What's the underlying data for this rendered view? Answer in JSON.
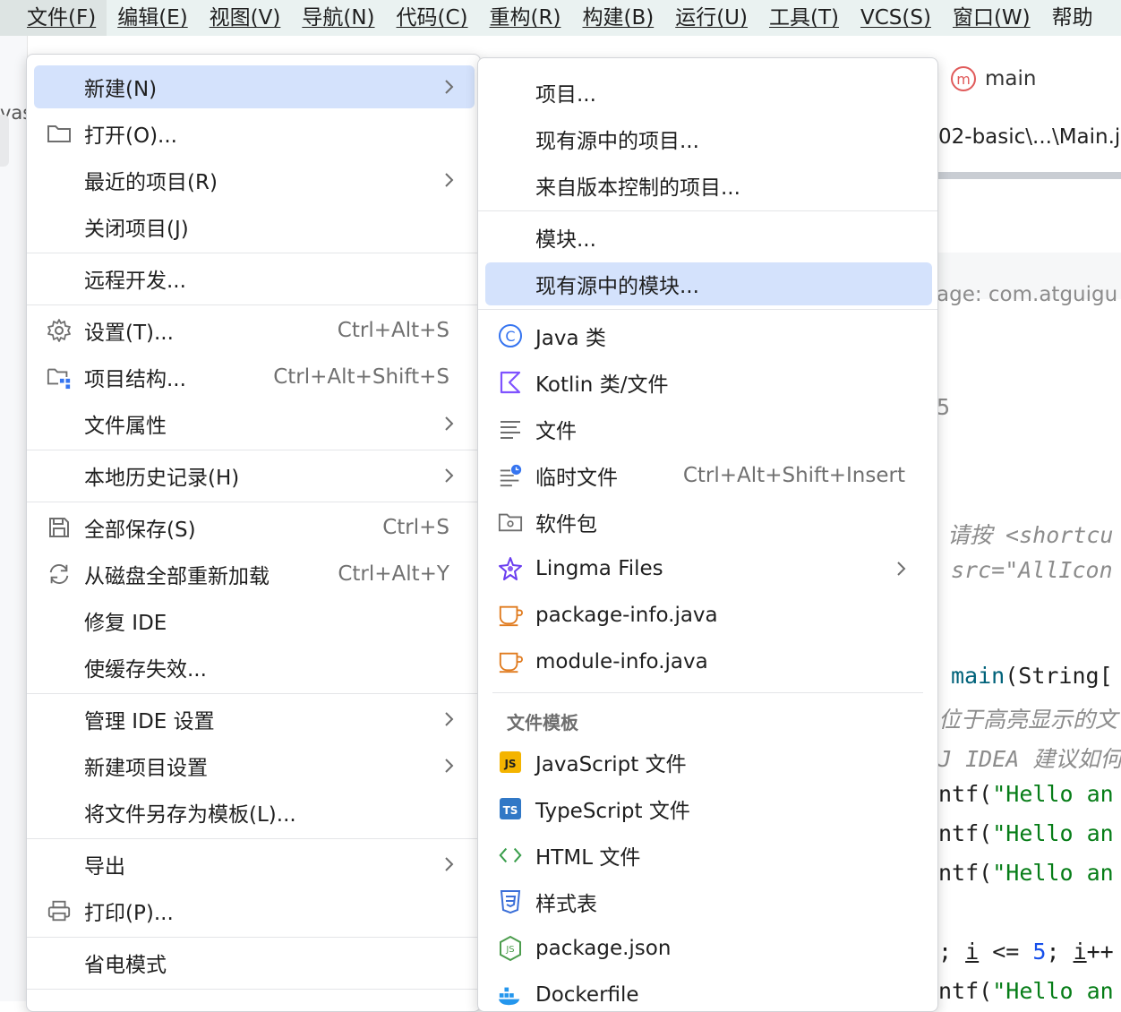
{
  "menubar": {
    "items": [
      "文件(F)",
      "编辑(E)",
      "视图(V)",
      "导航(N)",
      "代码(C)",
      "重构(R)",
      "构建(B)",
      "运行(U)",
      "工具(T)",
      "VCS(S)",
      "窗口(W)",
      "帮助"
    ]
  },
  "background": {
    "left_strip_text": "vas",
    "tab_label": "main",
    "tab_icon_glyph": "m",
    "breadcrumb": "02-basic\\...\\Main.j",
    "package_line": "age: com.atguigu",
    "stray_char": "5",
    "code": {
      "l1_comment": "请按 <shortcu",
      "l2_comment": "src=\"AllIcon",
      "l3_fn": "main",
      "l3_rest": "(String[",
      "l4_comment": "位于高亮显示的文",
      "l5_comment": "J IDEA 建议如何",
      "l6_pre": "ntf(",
      "l6_str": "\"Hello an",
      "l7_pre": "ntf(",
      "l7_str": "\"Hello an",
      "l8_pre": "ntf(",
      "l8_str": "\"Hello an",
      "l9_a": "; ",
      "l9_i1": "i",
      "l9_b": " <= ",
      "l9_num": "5",
      "l9_c": "; ",
      "l9_i2": "i",
      "l9_d": "++",
      "l10_pre": "ntf(",
      "l10_str": "\"Hello an"
    }
  },
  "file_menu": {
    "items": [
      {
        "label": "新建(N)",
        "shortcut": "",
        "submenu": true,
        "selected": true
      },
      {
        "label": "打开(O)...",
        "shortcut": "",
        "icon": "folder-icon"
      },
      {
        "label": "最近的项目(R)",
        "shortcut": "",
        "submenu": true
      },
      {
        "label": "关闭项目(J)",
        "shortcut": ""
      },
      {
        "label": "远程开发...",
        "shortcut": ""
      },
      {
        "label": "设置(T)...",
        "shortcut": "Ctrl+Alt+S",
        "icon": "gear-icon"
      },
      {
        "label": "项目结构...",
        "shortcut": "Ctrl+Alt+Shift+S",
        "icon": "project-structure-icon"
      },
      {
        "label": "文件属性",
        "shortcut": "",
        "submenu": true
      },
      {
        "label": "本地历史记录(H)",
        "shortcut": "",
        "submenu": true
      },
      {
        "label": "全部保存(S)",
        "shortcut": "Ctrl+S",
        "icon": "save-icon"
      },
      {
        "label": "从磁盘全部重新加载",
        "shortcut": "Ctrl+Alt+Y",
        "icon": "reload-icon"
      },
      {
        "label": "修复 IDE",
        "shortcut": ""
      },
      {
        "label": "使缓存失效...",
        "shortcut": ""
      },
      {
        "label": "管理 IDE 设置",
        "shortcut": "",
        "submenu": true
      },
      {
        "label": "新建项目设置",
        "shortcut": "",
        "submenu": true
      },
      {
        "label": "将文件另存为模板(L)...",
        "shortcut": ""
      },
      {
        "label": "导出",
        "shortcut": "",
        "submenu": true
      },
      {
        "label": "打印(P)...",
        "shortcut": "",
        "icon": "print-icon"
      },
      {
        "label": "省电模式",
        "shortcut": ""
      }
    ]
  },
  "new_submenu": {
    "items": [
      {
        "label": "项目..."
      },
      {
        "label": "现有源中的项目..."
      },
      {
        "label": "来自版本控制的项目..."
      },
      {
        "label": "模块..."
      },
      {
        "label": "现有源中的模块...",
        "selected": true
      },
      {
        "label": "Java 类",
        "icon": "java-class-icon"
      },
      {
        "label": "Kotlin 类/文件",
        "icon": "kotlin-icon"
      },
      {
        "label": "文件",
        "icon": "text-file-icon"
      },
      {
        "label": "临时文件",
        "shortcut": "Ctrl+Alt+Shift+Insert",
        "icon": "scratch-file-icon"
      },
      {
        "label": "软件包",
        "icon": "package-folder-icon"
      },
      {
        "label": "Lingma Files",
        "submenu": true,
        "icon": "lingma-icon"
      },
      {
        "label": "package-info.java",
        "icon": "java-cup-icon"
      },
      {
        "label": "module-info.java",
        "icon": "java-cup-icon"
      },
      {
        "label": "JavaScript 文件",
        "icon": "javascript-icon"
      },
      {
        "label": "TypeScript 文件",
        "icon": "typescript-icon"
      },
      {
        "label": "HTML 文件",
        "icon": "html-icon"
      },
      {
        "label": "样式表",
        "icon": "css-icon"
      },
      {
        "label": "package.json",
        "icon": "nodejs-icon"
      },
      {
        "label": "Dockerfile",
        "icon": "docker-icon"
      }
    ],
    "section_title": "文件模板",
    "icon_texts": {
      "js": "JS",
      "ts": "TS",
      "html": "<>",
      "java_c": "C",
      "node": "JS"
    }
  },
  "colors": {
    "menubar_bg": "#eaf2f1",
    "selection": "#d4e2fc",
    "java_blue": "#3574f0",
    "kotlin_purple": "#7f52ff",
    "cup_orange": "#e07b1f",
    "js_yellow": "#f4b400",
    "ts_blue": "#3178c6",
    "html_green": "#3a9e4c",
    "css_blue": "#3b6fd8",
    "node_green": "#4d9d4e",
    "docker_blue": "#2496ed"
  }
}
